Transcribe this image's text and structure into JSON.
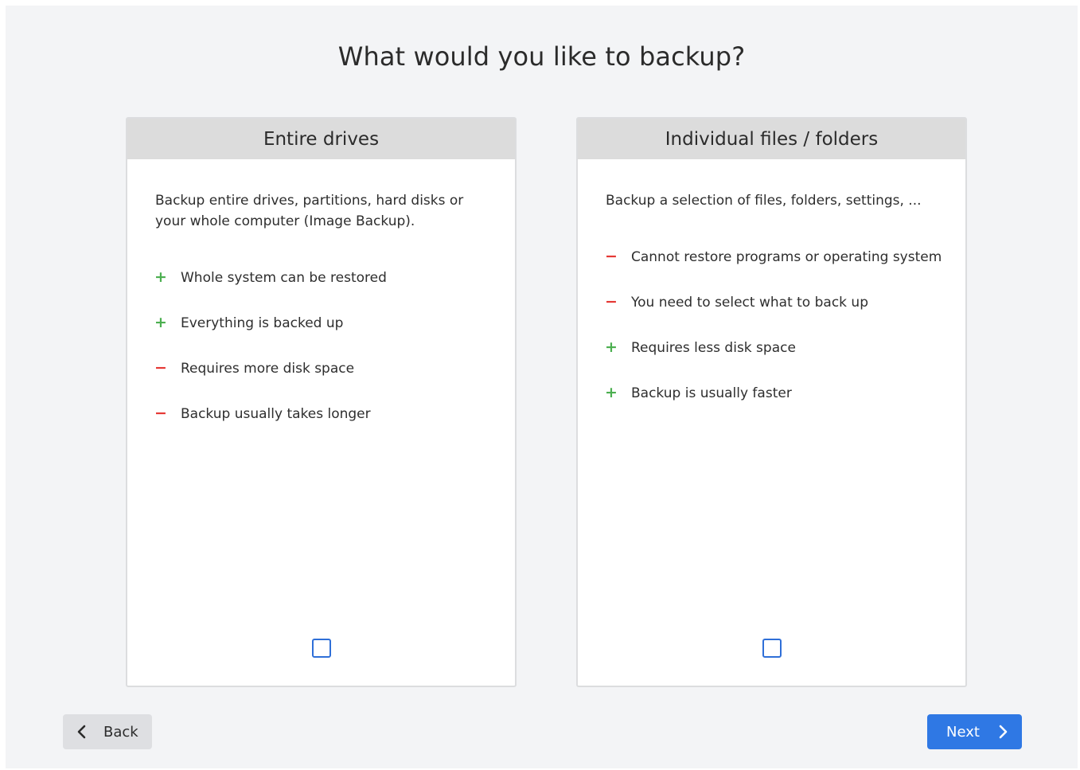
{
  "title": "What would you like to backup?",
  "options": [
    {
      "header": "Entire drives",
      "description": "Backup entire drives, partitions, hard disks or your whole computer (Image Backup).",
      "features": [
        {
          "sign": "+",
          "type": "pro",
          "text": "Whole system can be restored"
        },
        {
          "sign": "+",
          "type": "pro",
          "text": "Everything is backed up"
        },
        {
          "sign": "−",
          "type": "con",
          "text": "Requires more disk space"
        },
        {
          "sign": "−",
          "type": "con",
          "text": "Backup usually takes longer"
        }
      ],
      "checked": false
    },
    {
      "header": "Individual files / folders",
      "description": "Backup a selection of files, folders, settings, ...",
      "features": [
        {
          "sign": "−",
          "type": "con",
          "text": "Cannot restore programs or operating system"
        },
        {
          "sign": "−",
          "type": "con",
          "text": "You need to select what to back up"
        },
        {
          "sign": "+",
          "type": "pro",
          "text": "Requires less disk space"
        },
        {
          "sign": "+",
          "type": "pro",
          "text": "Backup is usually faster"
        }
      ],
      "checked": false
    }
  ],
  "buttons": {
    "back_label": "Back",
    "next_label": "Next"
  },
  "colors": {
    "accent": "#2f78e4",
    "pro": "#4caf50",
    "con": "#e53935"
  },
  "icons": {
    "back": "chevron-left-icon",
    "next": "chevron-right-icon",
    "pro": "plus-icon",
    "con": "minus-icon"
  }
}
